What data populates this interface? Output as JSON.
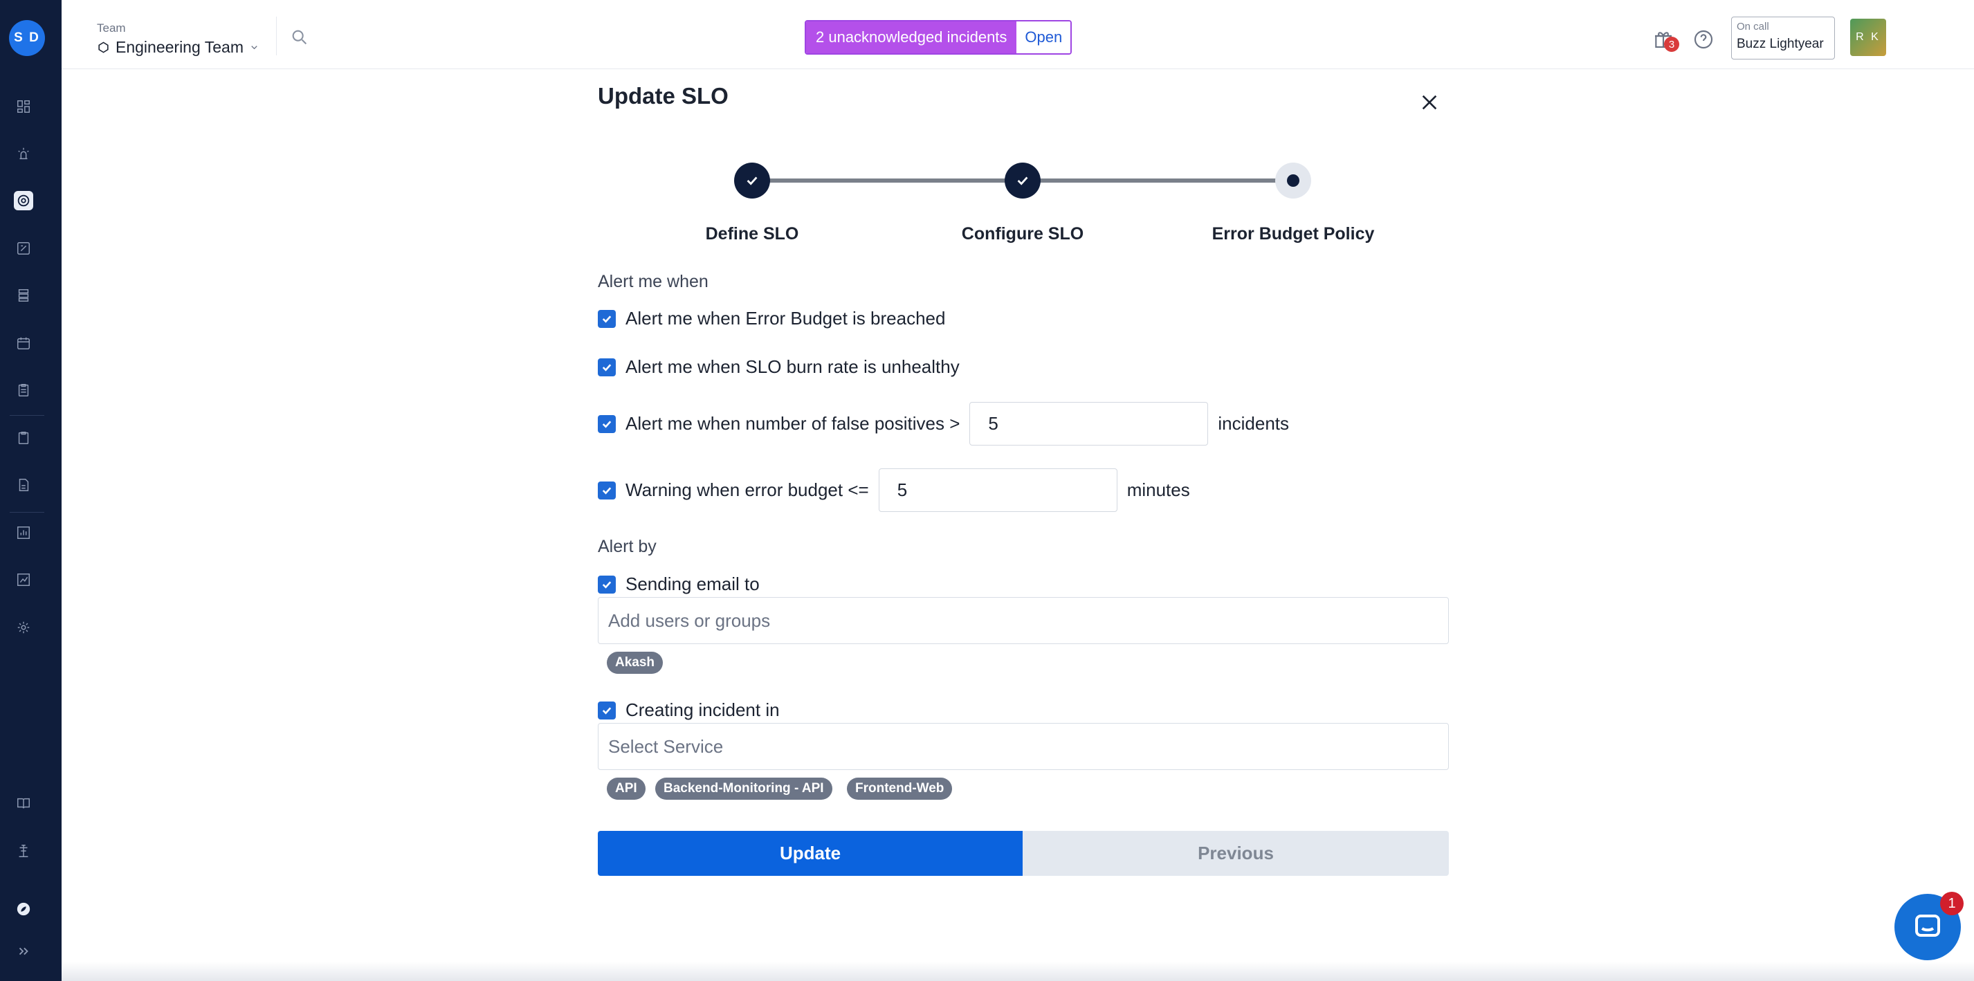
{
  "sidebar": {
    "avatar_initials": "S D",
    "icons": [
      "dashboard-icon",
      "incidents-icon",
      "slo-icon",
      "postmortem-icon",
      "services-icon",
      "schedules-icon",
      "runbooks-icon",
      "status-pages-icon",
      "reports-icon",
      "analytics-icon",
      "insights-icon",
      "settings-icon",
      "docs-icon",
      "integrations-icon",
      "squadcast-logo-icon",
      "expand-icon"
    ]
  },
  "topbar": {
    "team_label": "Team",
    "team_name": "Engineering Team",
    "incident_banner_text": "2 unacknowledged incidents",
    "incident_open_label": "Open",
    "gift_badge_count": "3",
    "oncall_label": "On call",
    "oncall_name": "Buzz Lightyear",
    "user_initials": "R K"
  },
  "modal": {
    "title": "Update SLO",
    "steps": [
      {
        "label": "Define SLO",
        "state": "done"
      },
      {
        "label": "Configure SLO",
        "state": "done"
      },
      {
        "label": "Error Budget Policy",
        "state": "current"
      }
    ],
    "alert_section_label": "Alert me when",
    "alerts": {
      "budget_breached": "Alert me when Error Budget is breached",
      "burn_rate": "Alert me when SLO burn rate is unhealthy",
      "false_positives": "Alert me when number of false positives >",
      "false_positives_value": "5",
      "false_positives_unit": "incidents",
      "warning": "Warning when error budget <=",
      "warning_value": "5",
      "warning_unit": "minutes"
    },
    "alert_by_label": "Alert by",
    "email": {
      "label": "Sending email to",
      "placeholder": "Add users or groups",
      "chips": [
        "Akash"
      ]
    },
    "incident": {
      "label": "Creating incident in",
      "placeholder": "Select Service",
      "chips": [
        "API",
        "Backend-Monitoring - API",
        "Frontend-Web"
      ]
    },
    "update_label": "Update",
    "previous_label": "Previous"
  },
  "chat": {
    "badge_count": "1"
  },
  "colors": {
    "sidebar": "#0f1d3b",
    "primary": "#0b63de",
    "incident_banner": "#b450ea",
    "checkbox": "#1f6ad6"
  }
}
